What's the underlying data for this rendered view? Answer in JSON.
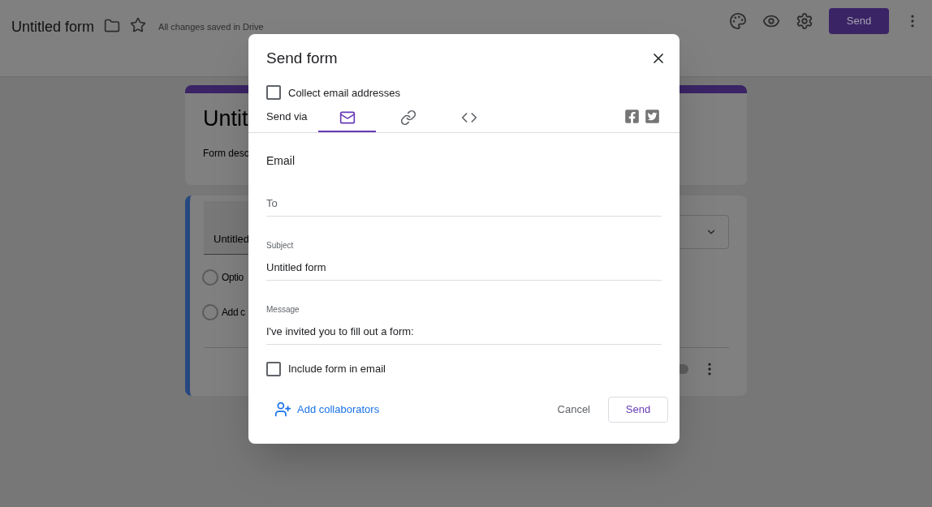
{
  "header": {
    "title": "Untitled form",
    "save_status": "All changes saved in Drive",
    "send_button": "Send"
  },
  "form": {
    "title": "Untit",
    "description": "Form desc",
    "question": {
      "title": "Untitled",
      "options": [
        {
          "kind": "radio",
          "label": "Optio",
          "selected": false
        },
        {
          "kind": "radio",
          "label": "Add c",
          "selected": false
        }
      ],
      "required": {
        "on": false
      }
    }
  },
  "dialog": {
    "title": "Send form",
    "collect_email": {
      "label": "Collect email addresses",
      "checked": false
    },
    "send_via_label": "Send via",
    "methods": [
      {
        "kind": "email",
        "selected": true
      },
      {
        "kind": "link",
        "selected": false
      },
      {
        "kind": "embed",
        "selected": false
      }
    ],
    "section_title": "Email",
    "fields": [
      {
        "placeholder": "To"
      },
      {
        "label": "Subject",
        "value": "Untitled form"
      },
      {
        "label": "Message",
        "value": "I've invited you to fill out a form:"
      }
    ],
    "include_form": {
      "label": "Include form in email",
      "checked": false
    },
    "add_collaborators": "Add collaborators",
    "cancel": "Cancel",
    "send": "Send"
  }
}
